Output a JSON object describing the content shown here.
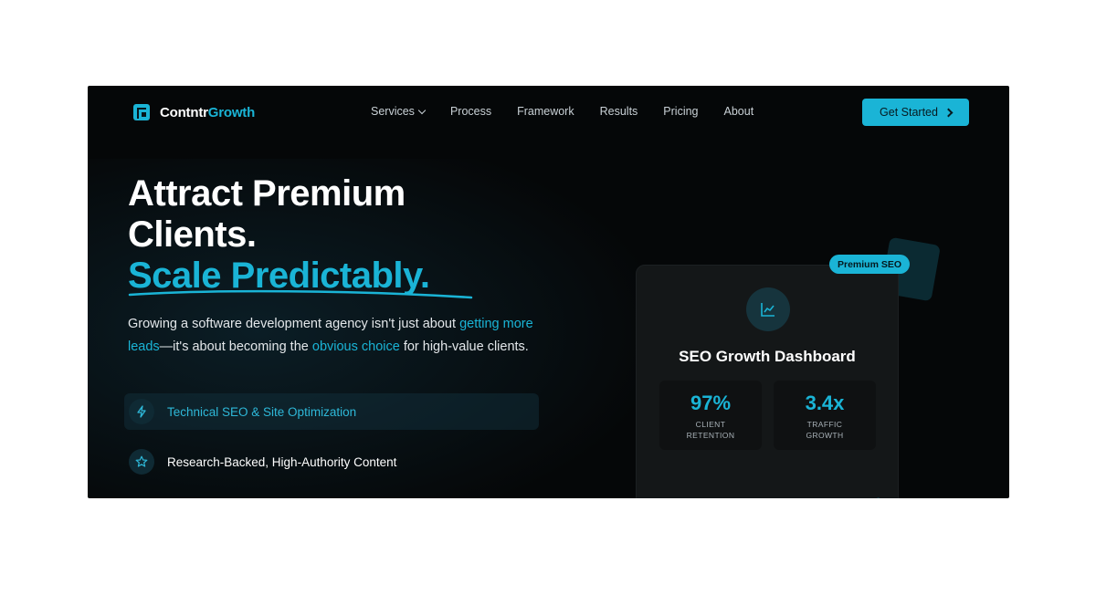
{
  "brand": {
    "name_part1": "Contntr",
    "name_part2": "Growth"
  },
  "nav": {
    "items": [
      {
        "label": "Services",
        "has_dropdown": true
      },
      {
        "label": "Process"
      },
      {
        "label": "Framework"
      },
      {
        "label": "Results"
      },
      {
        "label": "Pricing"
      },
      {
        "label": "About"
      }
    ],
    "cta_label": "Get Started"
  },
  "hero": {
    "title_line1": "Attract Premium",
    "title_line2": "Clients.",
    "title_accent": "Scale Predictably.",
    "lead_part1": "Growing a software development agency isn't just about ",
    "lead_hl1": "getting more leads",
    "lead_part2": "—it's about becoming the ",
    "lead_hl2": "obvious choice",
    "lead_part3": " for high-value clients.",
    "features": [
      {
        "label": "Technical SEO & Site Optimization",
        "icon": "lightning-icon",
        "active": true
      },
      {
        "label": "Research-Backed, High-Authority Content",
        "icon": "star-icon",
        "active": false
      }
    ]
  },
  "dashboard": {
    "badge": "Premium SEO",
    "title": "SEO Growth Dashboard",
    "icon": "line-chart-icon",
    "stats": [
      {
        "value": "97%",
        "label": "CLIENT RETENTION"
      },
      {
        "value": "3.4x",
        "label": "TRAFFIC GROWTH"
      }
    ]
  },
  "colors": {
    "accent": "#1ab4d6",
    "background": "#050708",
    "card": "#141718"
  }
}
